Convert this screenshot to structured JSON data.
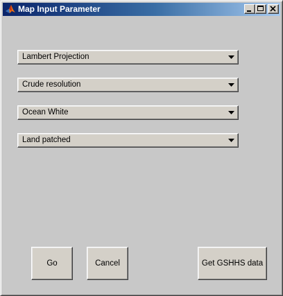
{
  "window": {
    "title": "Map Input Parameter",
    "app_icon": "matlab-logo-icon",
    "controls": [
      "minimize-icon",
      "maximize-icon",
      "close-icon"
    ]
  },
  "popups": [
    {
      "selected": "Lambert Projection"
    },
    {
      "selected": "Crude resolution"
    },
    {
      "selected": "Ocean White"
    },
    {
      "selected": "Land patched"
    }
  ],
  "buttons": {
    "go": "Go",
    "cancel": "Cancel",
    "get_gshhs": "Get GSHHS data"
  },
  "colors": {
    "title_start": "#0a246a",
    "title_end": "#a6caf0",
    "background": "#c8c8c8",
    "control_face": "#d4d0c8"
  }
}
